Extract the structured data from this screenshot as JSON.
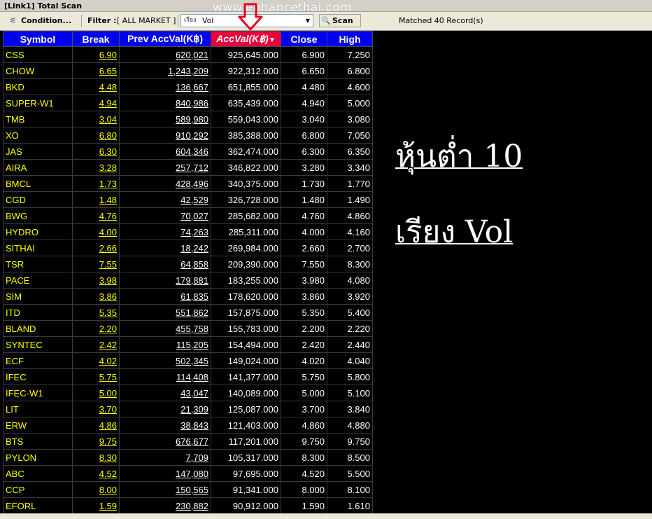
{
  "window": {
    "title": "[Link1] Total Scan"
  },
  "watermark": "www.enhancethai.com",
  "toolbar": {
    "condition_label": "Condition...",
    "filter_label": "Filter :",
    "filter_value": "[ ALL MARKET ]",
    "select_prefix": "เรียง",
    "select_value": "Vol",
    "scan_label": "Scan",
    "matched_text": "Matched 40 Record(s)"
  },
  "table": {
    "headers": [
      "Symbol",
      "Break",
      "Prev AccVal(K฿)",
      "AccVal(K฿)",
      "Close",
      "High"
    ],
    "sorted_column": 3,
    "rows": [
      [
        "CSS",
        "6.90",
        "620,021",
        "925,645.000",
        "6.900",
        "7.250"
      ],
      [
        "CHOW",
        "6.65",
        "1,243,209",
        "922,312.000",
        "6.650",
        "6.800"
      ],
      [
        "BKD",
        "4.48",
        "136,667",
        "651,855.000",
        "4.480",
        "4.600"
      ],
      [
        "SUPER-W1",
        "4.94",
        "840,986",
        "635,439.000",
        "4.940",
        "5.000"
      ],
      [
        "TMB",
        "3.04",
        "589,980",
        "559,043.000",
        "3.040",
        "3.080"
      ],
      [
        "XO",
        "6.80",
        "910,292",
        "385,388.000",
        "6.800",
        "7.050"
      ],
      [
        "JAS",
        "6.30",
        "604,346",
        "362,474.000",
        "6.300",
        "6.350"
      ],
      [
        "AIRA",
        "3.28",
        "257,712",
        "346,822.000",
        "3.280",
        "3.340"
      ],
      [
        "BMCL",
        "1.73",
        "428,496",
        "340,375.000",
        "1.730",
        "1.770"
      ],
      [
        "CGD",
        "1.48",
        "42,529",
        "326,728.000",
        "1.480",
        "1.490"
      ],
      [
        "BWG",
        "4.76",
        "70,027",
        "285,682.000",
        "4.760",
        "4.860"
      ],
      [
        "HYDRO",
        "4.00",
        "74,263",
        "285,311.000",
        "4.000",
        "4.160"
      ],
      [
        "SITHAI",
        "2.66",
        "18,242",
        "269,984.000",
        "2.660",
        "2.700"
      ],
      [
        "TSR",
        "7.55",
        "64,858",
        "209,390.000",
        "7.550",
        "8.300"
      ],
      [
        "PACE",
        "3.98",
        "179,881",
        "183,255.000",
        "3.980",
        "4.080"
      ],
      [
        "SIM",
        "3.86",
        "61,835",
        "178,620.000",
        "3.860",
        "3.920"
      ],
      [
        "ITD",
        "5.35",
        "551,862",
        "157,875.000",
        "5.350",
        "5.400"
      ],
      [
        "BLAND",
        "2.20",
        "455,758",
        "155,783.000",
        "2.200",
        "2.220"
      ],
      [
        "SYNTEC",
        "2.42",
        "115,205",
        "154,494.000",
        "2.420",
        "2.440"
      ],
      [
        "ECF",
        "4.02",
        "502,345",
        "149,024.000",
        "4.020",
        "4.040"
      ],
      [
        "IFEC",
        "5.75",
        "114,408",
        "141,377.000",
        "5.750",
        "5.800"
      ],
      [
        "IFEC-W1",
        "5.00",
        "43,047",
        "140,089.000",
        "5.000",
        "5.100"
      ],
      [
        "LIT",
        "3.70",
        "21,309",
        "125,087.000",
        "3.700",
        "3.840"
      ],
      [
        "ERW",
        "4.86",
        "38,843",
        "121,403.000",
        "4.860",
        "4.880"
      ],
      [
        "BTS",
        "9.75",
        "676,677",
        "117,201.000",
        "9.750",
        "9.750"
      ],
      [
        "PYLON",
        "8.30",
        "7,709",
        "105,317.000",
        "8.300",
        "8.500"
      ],
      [
        "ABC",
        "4.52",
        "147,080",
        "97,695.000",
        "4.520",
        "5.500"
      ],
      [
        "CCP",
        "8.00",
        "150,565",
        "91,341.000",
        "8.000",
        "8.100"
      ],
      [
        "EFORL",
        "1.59",
        "230,882",
        "90,912.000",
        "1.590",
        "1.610"
      ]
    ]
  },
  "annotation": {
    "line1": "หุ้นต่ำ 10",
    "line2": "เรียง Vol"
  },
  "colors": {
    "header_bg": "#0000ee",
    "sorted_header_bg": "#e8003a",
    "symbol_text": "#ffff00",
    "arrow": "#e8001c"
  }
}
